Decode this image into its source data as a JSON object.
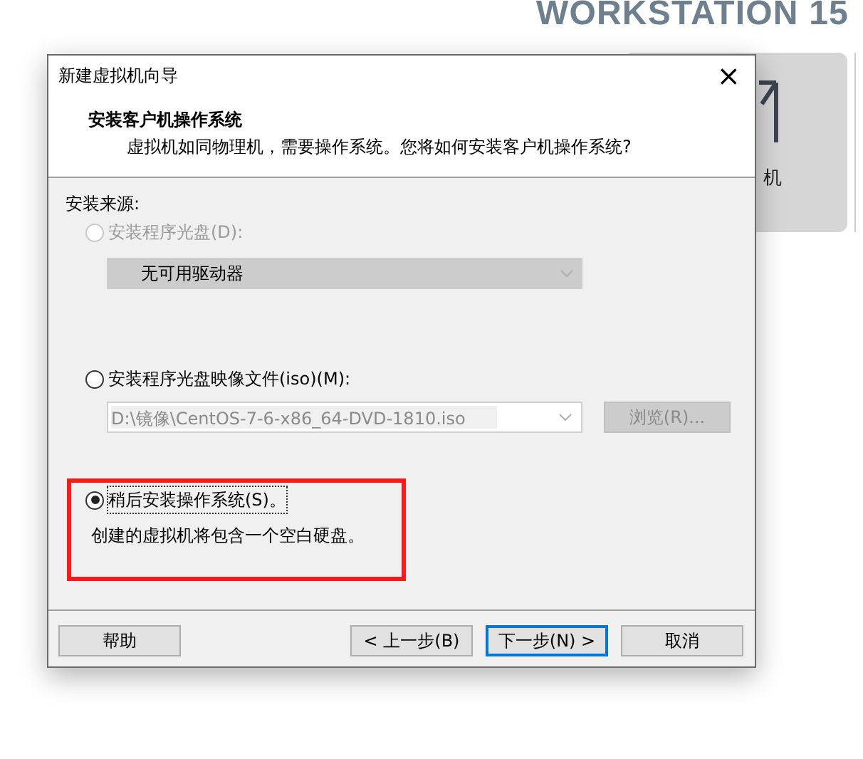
{
  "background": {
    "product_title": "WORKSTATION 15",
    "card_label": "机"
  },
  "window": {
    "title": "新建虚拟机向导",
    "close": "×"
  },
  "header": {
    "title": "安装客户机操作系统",
    "subtitle": "虚拟机如同物理机，需要操作系统。您将如何安装客户机操作系统?"
  },
  "section_label": "安装来源:",
  "options": [
    {
      "kind": "disc",
      "label": "安装程序光盘(D):",
      "selected": false,
      "disabled": true,
      "highlighted": false,
      "dropdown": "无可用驱动器"
    },
    {
      "kind": "iso",
      "label": "安装程序光盘映像文件(iso)(M):",
      "selected": false,
      "disabled": false,
      "highlighted": false,
      "path": "D:\\镜像\\CentOS-7-6-x86_64-DVD-1810.iso",
      "path_disabled": true,
      "browse": {
        "label": "浏览(R)...",
        "disabled": true
      }
    },
    {
      "kind": "later",
      "label": "稍后安装操作系统(S)。",
      "selected": true,
      "disabled": false,
      "highlighted": true,
      "description": "创建的虚拟机将包含一个空白硬盘。"
    }
  ],
  "buttons": [
    {
      "label": "帮助",
      "focused": false
    },
    {
      "label": "< 上一步(B)",
      "focused": false
    },
    {
      "label": "下一步(N) >",
      "focused": true
    },
    {
      "label": "取消",
      "focused": false
    }
  ]
}
